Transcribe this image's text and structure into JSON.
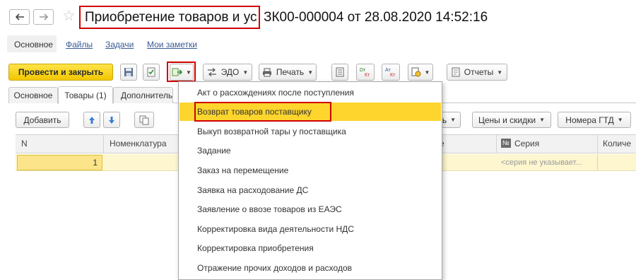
{
  "window": {
    "title": "Приобретение товаров и услуг",
    "doc_number": "ЗК00-000004 от 28.08.2020 14:52:16"
  },
  "form_tabs": [
    {
      "label": "Основное"
    },
    {
      "label": "Файлы"
    },
    {
      "label": "Задачи"
    },
    {
      "label": "Мои заметки"
    }
  ],
  "toolbar": {
    "post_close_label": "Провести и закрыть",
    "edo_label": "ЭДО",
    "print_label": "Печать",
    "reports_label": "Отчеты",
    "dt_label": "Dт",
    "ct_label": "Кт",
    "at_label": "Ат"
  },
  "page_tabs": [
    {
      "label": "Основное"
    },
    {
      "label": "Товары (1)"
    },
    {
      "label": "Дополнитель"
    }
  ],
  "goods_toolbar": {
    "add_label": "Добавить",
    "partial_label": "ь",
    "prices_label": "Цены и скидки",
    "gtd_label": "Номера ГТД"
  },
  "grid": {
    "col_n": "N",
    "col_nomenclature": "Номенклатура",
    "col_hidden": "е",
    "col_series_badge": "№",
    "col_series": "Серия",
    "col_qty": "Количе",
    "row_n": "1",
    "row_series_placeholder": "<серия не указывает..."
  },
  "create_menu": {
    "items": [
      "Акт о расхождениях после поступления",
      "Возврат товаров поставщику",
      "Выкуп возвратной тары у поставщика",
      "Задание",
      "Заказ на перемещение",
      "Заявка на расходование ДС",
      "Заявление о ввозе товаров из ЕАЭС",
      "Корректировка вида деятельности НДС",
      "Корректировка приобретения",
      "Отражение прочих доходов и расходов"
    ],
    "highlighted_index": 1
  },
  "colors": {
    "accent_yellow": "#fdd52c",
    "highlight_red": "#d00000",
    "link_blue": "#3a5a95"
  }
}
